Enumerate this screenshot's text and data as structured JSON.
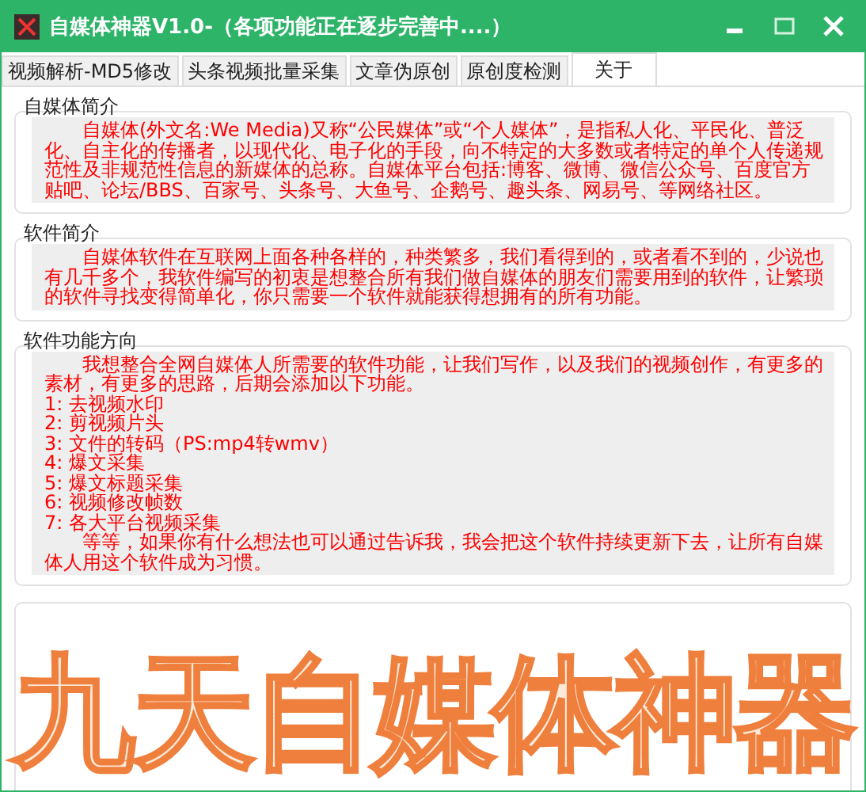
{
  "window": {
    "title": "自媒体神器V1.0-（各项功能正在逐步完善中....）"
  },
  "tabs": [
    {
      "label": "视频解析-MD5修改",
      "selected": false
    },
    {
      "label": "头条视频批量采集",
      "selected": false
    },
    {
      "label": "文章伪原创",
      "selected": false
    },
    {
      "label": "原创度检测",
      "selected": false
    },
    {
      "label": "关于",
      "selected": true
    }
  ],
  "groups": [
    {
      "title": "自媒体简介",
      "lines": [
        "　　自媒体(外文名:We Media)又称“公民媒体”或“个人媒体”，是指私人化、平民化、普泛化、自主化的传播者，以现代化、电子化的手段，向不特定的大多数或者特定的单个人传递规范性及非规范性信息的新媒体的总称。自媒体平台包括:博客、微博、微信公众号、百度官方贴吧、论坛/BBS、百家号、头条号、大鱼号、企鹅号、趣头条、网易号、等网络社区。"
      ]
    },
    {
      "title": "软件简介",
      "lines": [
        "　　自媒体软件在互联网上面各种各样的，种类繁多，我们看得到的，或者看不到的，少说也有几千多个，我软件编写的初衷是想整合所有我们做自媒体的朋友们需要用到的软件，让繁琐的软件寻找变得简单化，你只需要一个软件就能获得想拥有的所有功能。"
      ]
    },
    {
      "title": "软件功能方向",
      "lines": [
        "　　我想整合全网自媒体人所需要的软件功能，让我们写作，以及我们的视频创作，有更多的素材，有更多的思路，后期会添加以下功能。",
        "1: 去视频水印",
        "2: 剪视频片头",
        "3: 文件的转码（PS:mp4转wmv）",
        "4: 爆文采集",
        "5: 爆文标题采集",
        "6: 视频修改帧数",
        "7: 各大平台视频采集",
        "　　等等，如果你有什么想法也可以通过告诉我，我会把这个软件持续更新下去，让所有自媒体人用这个软件成为习惯。"
      ]
    }
  ],
  "banner": {
    "text": "九天自媒体神器"
  }
}
